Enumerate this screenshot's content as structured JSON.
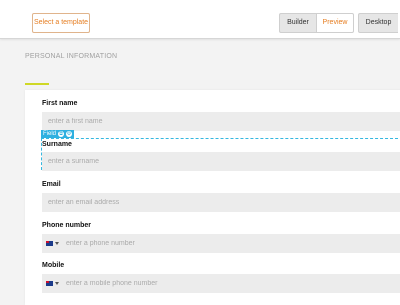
{
  "toolbar": {
    "select_template_label": "Select a template",
    "builder_label": "Builder",
    "preview_label": "Preview",
    "desktop_label": "Desktop"
  },
  "section": {
    "title": "PERSONAL INFORMATION",
    "accent_color": "#cfd826"
  },
  "field_tag": {
    "label": "Field",
    "icons": [
      "copy-icon",
      "settings-icon"
    ]
  },
  "form": {
    "fields": [
      {
        "label": "First name",
        "placeholder": "enter a first name"
      },
      {
        "label": "Surname",
        "placeholder": "enter a surname"
      },
      {
        "label": "Email",
        "placeholder": "enter an email address"
      },
      {
        "label": "Phone number",
        "placeholder": "enter a phone number",
        "flag_icon": "australia-flag-icon"
      },
      {
        "label": "Mobile",
        "placeholder": "enter a mobile phone number",
        "flag_icon": "australia-flag-icon"
      }
    ]
  },
  "colors": {
    "accent_orange": "#e67e22",
    "selection_blue": "#2fb0e0"
  }
}
